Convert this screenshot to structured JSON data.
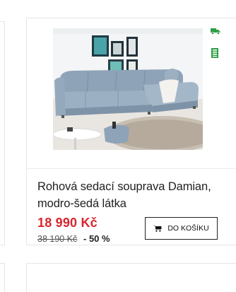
{
  "product": {
    "name": "Rohová sedací souprava Damian, modro-šedá látka",
    "price": "18 990 Kč",
    "original_price": "38 190 Kč",
    "discount": "- 50 %",
    "add_to_cart_label": "DO KOŠÍKU",
    "image_alt": "Rohová sedací souprava Damian"
  },
  "icons": {
    "delivery": "delivery-truck-icon",
    "stock": "stock-availability-icon",
    "cart": "shopping-cart-icon"
  },
  "colors": {
    "price": "#d8262e",
    "badge_green": "#2e9e47",
    "sofa": "#8fa3b8",
    "border": "#e6e6e6"
  }
}
